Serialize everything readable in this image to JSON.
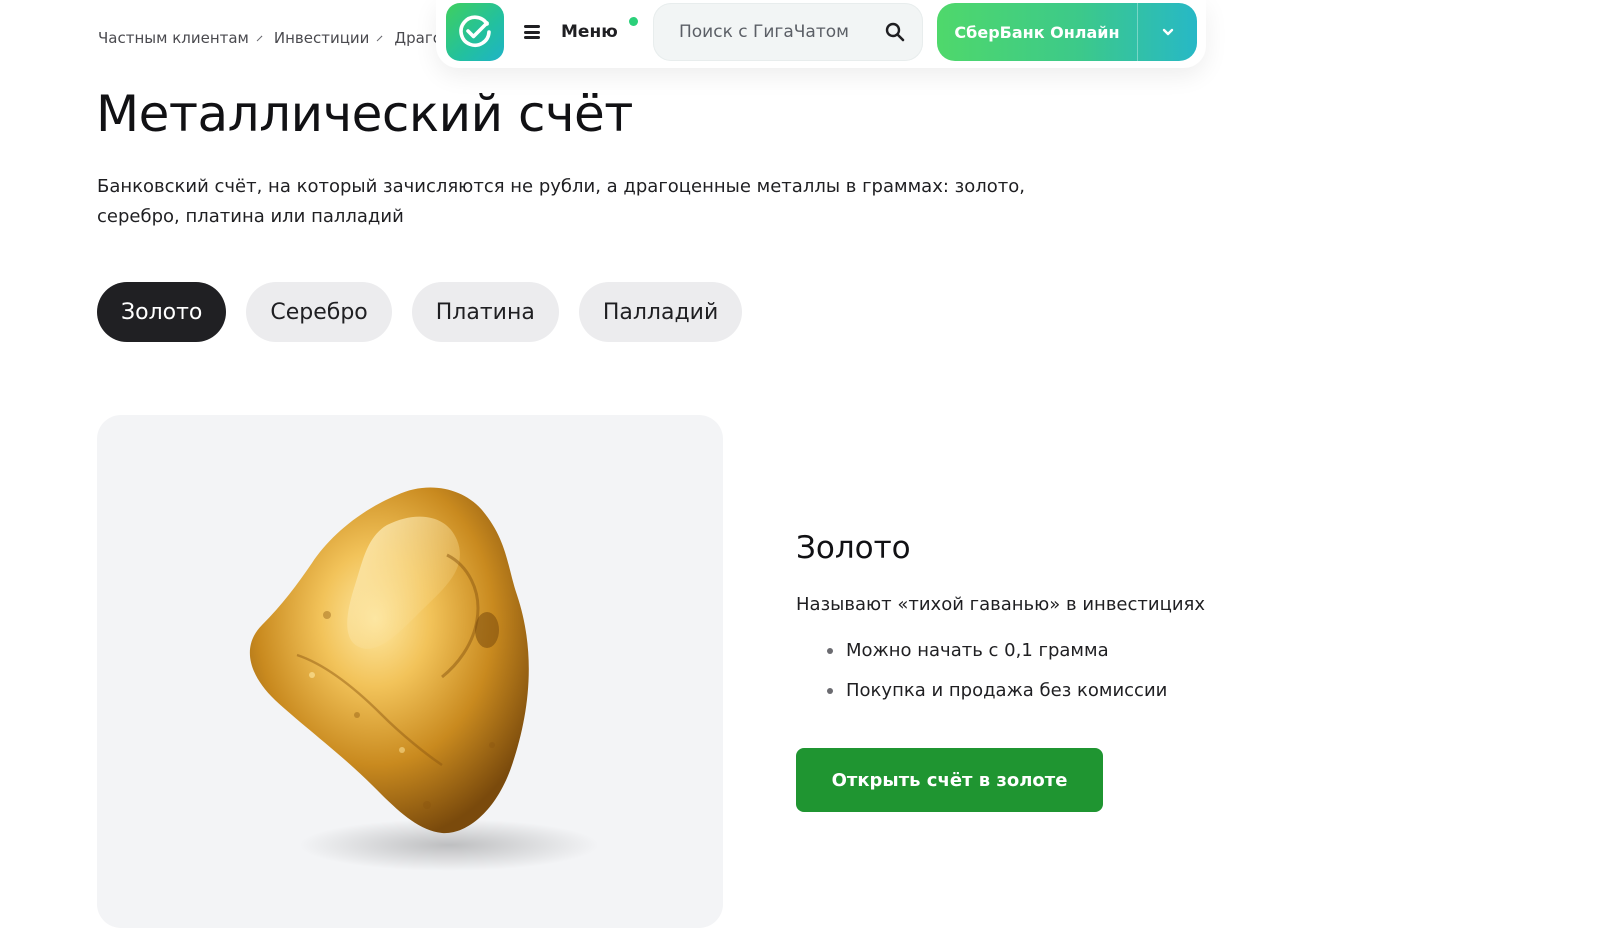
{
  "breadcrumb": {
    "items": [
      "Частным клиентам",
      "Инвестиции",
      "Драгоценные металлы"
    ]
  },
  "header": {
    "logo_icon": "sber-check-icon",
    "menu_label": "Меню",
    "search_placeholder": "Поиск с ГигаЧатом",
    "search_icon": "search-icon",
    "online_label": "СберБанк Онлайн",
    "dropdown_icon": "chevron-down-icon"
  },
  "page": {
    "title": "Металлический счёт",
    "lead": "Банковский счёт, на который зачисляются не рубли, а драгоценные металлы в граммах: золото, серебро, платина или палладий"
  },
  "tabs": [
    {
      "label": "Золото",
      "active": true
    },
    {
      "label": "Серебро",
      "active": false
    },
    {
      "label": "Платина",
      "active": false
    },
    {
      "label": "Палладий",
      "active": false
    }
  ],
  "product": {
    "title": "Золото",
    "subtitle": "Называют «тихой гаванью» в инвестициях",
    "bullets": [
      "Можно начать с 0,1 грамма",
      "Покупка и продажа без комиссии"
    ],
    "button_label": "Открыть счёт в золоте",
    "image": "gold-nugget"
  },
  "colors": {
    "brand_green": "#1f9531",
    "tab_active": "#202023",
    "tab_inactive": "#ececee",
    "gradient_start": "#4fd86b",
    "gradient_end": "#27b8c6"
  }
}
